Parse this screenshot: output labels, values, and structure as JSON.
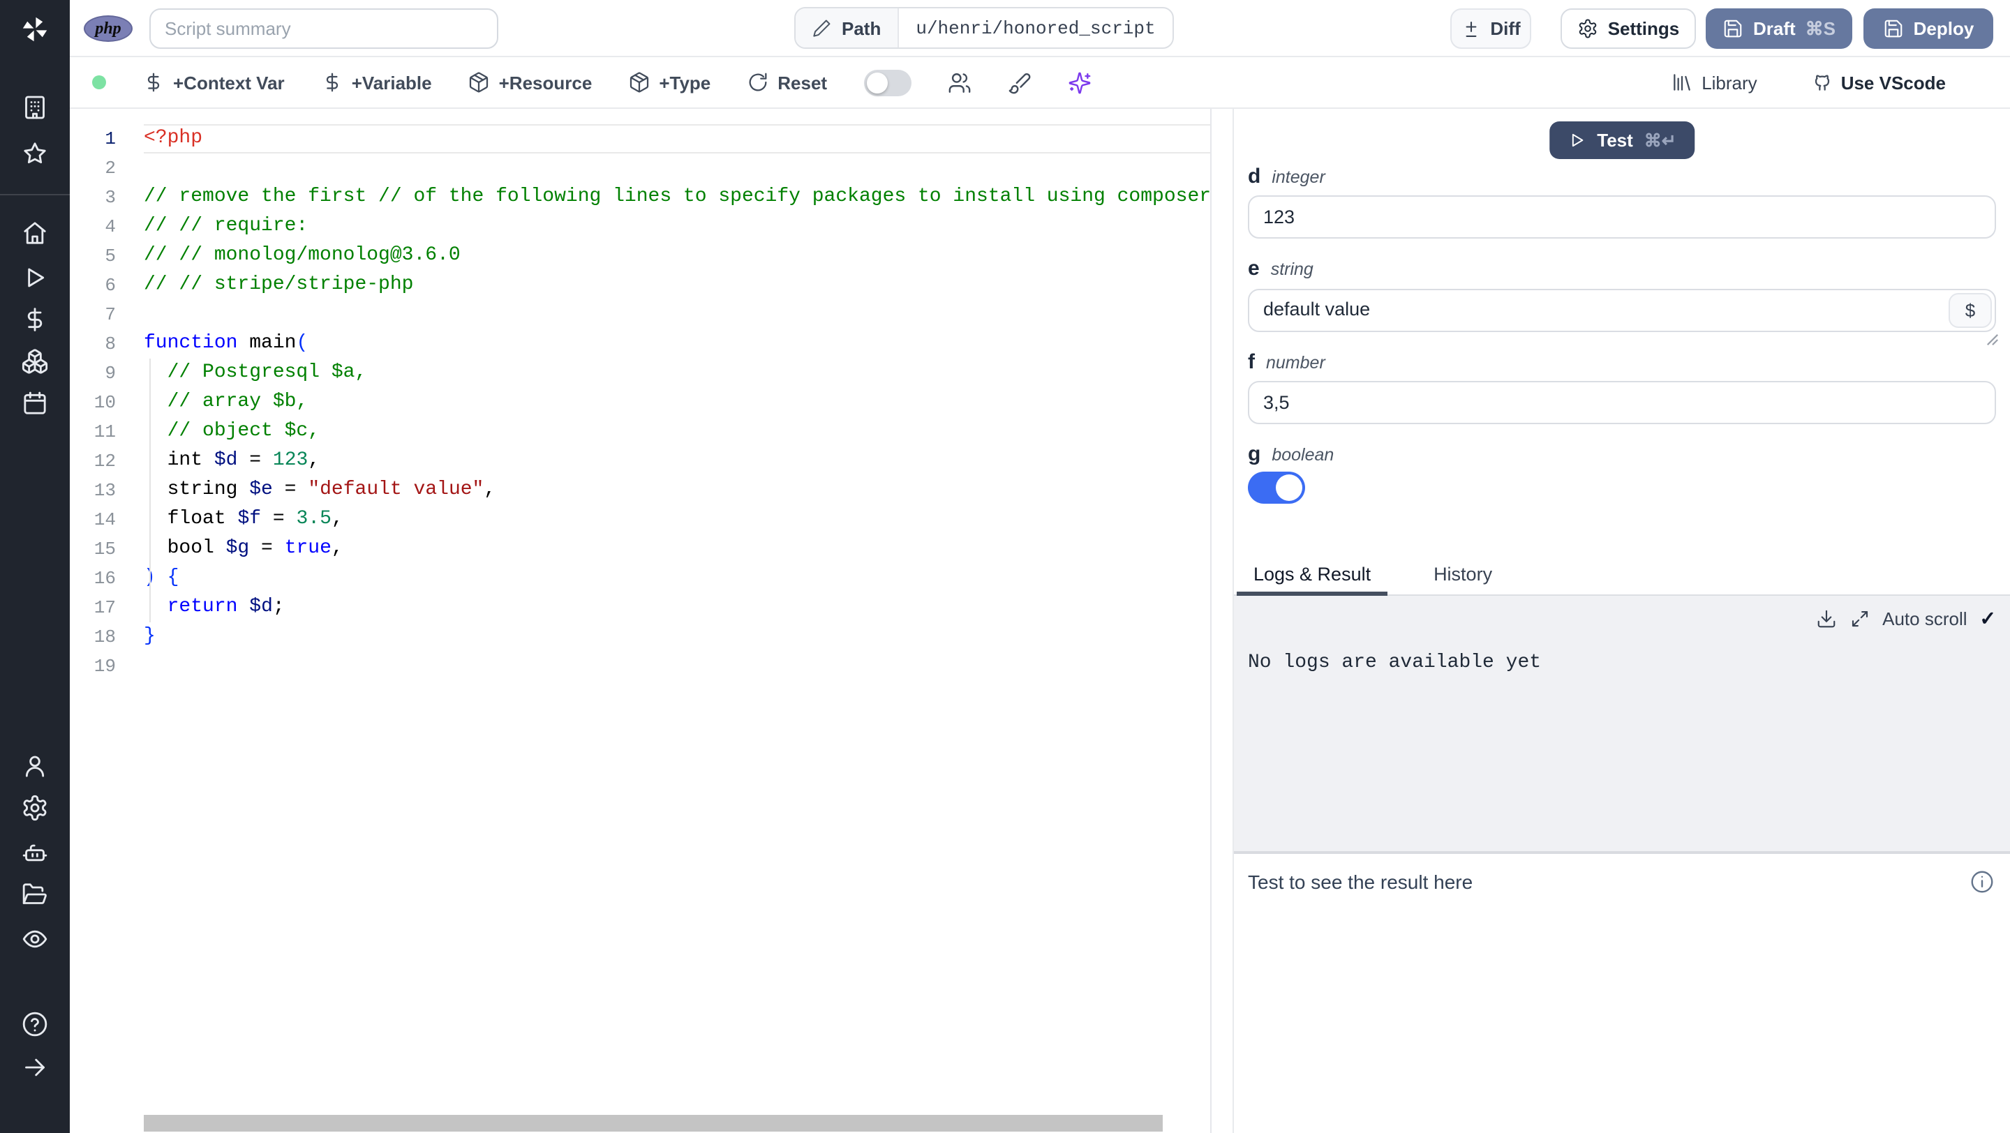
{
  "topbar": {
    "language_badge": "php",
    "summary_placeholder": "Script summary",
    "path_label": "Path",
    "path_value": "u/henri/honored_script",
    "diff_label": "Diff",
    "settings_label": "Settings",
    "draft_label": "Draft",
    "draft_shortcut": "⌘S",
    "deploy_label": "Deploy"
  },
  "toolbar": {
    "add_context_var": "+Context Var",
    "add_variable": "+Variable",
    "add_resource": "+Resource",
    "add_type": "+Type",
    "reset_label": "Reset",
    "library_label": "Library",
    "vscode_label": "Use VScode"
  },
  "icons": {
    "dollar_glyph": "$",
    "check_glyph": "✓"
  },
  "editor": {
    "language": "php",
    "active_line": 1,
    "lines": [
      {
        "n": 1,
        "tokens": [
          [
            "tag",
            "<?php"
          ]
        ]
      },
      {
        "n": 2,
        "tokens": []
      },
      {
        "n": 3,
        "tokens": [
          [
            "com",
            "// remove the first // of the following lines to specify packages to install using composer"
          ]
        ]
      },
      {
        "n": 4,
        "tokens": [
          [
            "com",
            "// // require:"
          ]
        ]
      },
      {
        "n": 5,
        "tokens": [
          [
            "com",
            "// // monolog/monolog@3.6.0"
          ]
        ]
      },
      {
        "n": 6,
        "tokens": [
          [
            "com",
            "// // stripe/stripe-php"
          ]
        ]
      },
      {
        "n": 7,
        "tokens": []
      },
      {
        "n": 8,
        "tokens": [
          [
            "kw",
            "function"
          ],
          [
            "pl",
            " main"
          ],
          [
            "br",
            "("
          ]
        ]
      },
      {
        "n": 9,
        "tokens": [
          [
            "com",
            "  // Postgresql $a,"
          ]
        ]
      },
      {
        "n": 10,
        "tokens": [
          [
            "com",
            "  // array $b,"
          ]
        ]
      },
      {
        "n": 11,
        "tokens": [
          [
            "com",
            "  // object $c,"
          ]
        ]
      },
      {
        "n": 12,
        "tokens": [
          [
            "pl",
            "  int "
          ],
          [
            "var",
            "$d"
          ],
          [
            "pl",
            " = "
          ],
          [
            "num",
            "123"
          ],
          [
            "pl",
            ","
          ]
        ]
      },
      {
        "n": 13,
        "tokens": [
          [
            "pl",
            "  string "
          ],
          [
            "var",
            "$e"
          ],
          [
            "pl",
            " = "
          ],
          [
            "str",
            "\"default value\""
          ],
          [
            "pl",
            ","
          ]
        ]
      },
      {
        "n": 14,
        "tokens": [
          [
            "pl",
            "  float "
          ],
          [
            "var",
            "$f"
          ],
          [
            "pl",
            " = "
          ],
          [
            "num",
            "3.5"
          ],
          [
            "pl",
            ","
          ]
        ]
      },
      {
        "n": 15,
        "tokens": [
          [
            "pl",
            "  bool "
          ],
          [
            "var",
            "$g"
          ],
          [
            "pl",
            " = "
          ],
          [
            "kw",
            "true"
          ],
          [
            "pl",
            ","
          ]
        ]
      },
      {
        "n": 16,
        "tokens": [
          [
            "br",
            ") {"
          ]
        ]
      },
      {
        "n": 17,
        "tokens": [
          [
            "pl",
            "  "
          ],
          [
            "kw",
            "return"
          ],
          [
            "pl",
            " "
          ],
          [
            "var",
            "$d"
          ],
          [
            "pl",
            ";"
          ]
        ]
      },
      {
        "n": 18,
        "tokens": [
          [
            "br",
            "}"
          ]
        ]
      },
      {
        "n": 19,
        "tokens": []
      }
    ]
  },
  "right": {
    "test_label": "Test",
    "test_shortcut": "⌘↵",
    "fields": [
      {
        "name": "d",
        "type": "integer",
        "value": "123",
        "widget": "input"
      },
      {
        "name": "e",
        "type": "string",
        "value": "default value",
        "widget": "textarea"
      },
      {
        "name": "f",
        "type": "number",
        "value": "3,5",
        "widget": "input"
      },
      {
        "name": "g",
        "type": "boolean",
        "value": true,
        "widget": "toggle"
      }
    ],
    "tabs": [
      {
        "label": "Logs & Result",
        "active": true
      },
      {
        "label": "History",
        "active": false
      }
    ],
    "autoscroll_label": "Auto scroll",
    "no_logs_text": "No logs are available yet",
    "result_placeholder": "Test to see the result here"
  },
  "sidebar": {
    "icons": [
      "workspace-building",
      "favorites-star",
      "home",
      "runs-play",
      "variables-dollar",
      "resources-boxes",
      "schedules-calendar",
      "user",
      "settings-gear",
      "workers-bot",
      "folders",
      "audit-eye",
      "help",
      "expand-arrow"
    ]
  },
  "colors": {
    "primary_button": "#66789f",
    "test_button": "#3c4a68",
    "toggle_on": "#3b6cf3",
    "status_dot": "#7de2a3",
    "ai_accent": "#7c3aed",
    "php_badge": "#7b7fb5"
  }
}
